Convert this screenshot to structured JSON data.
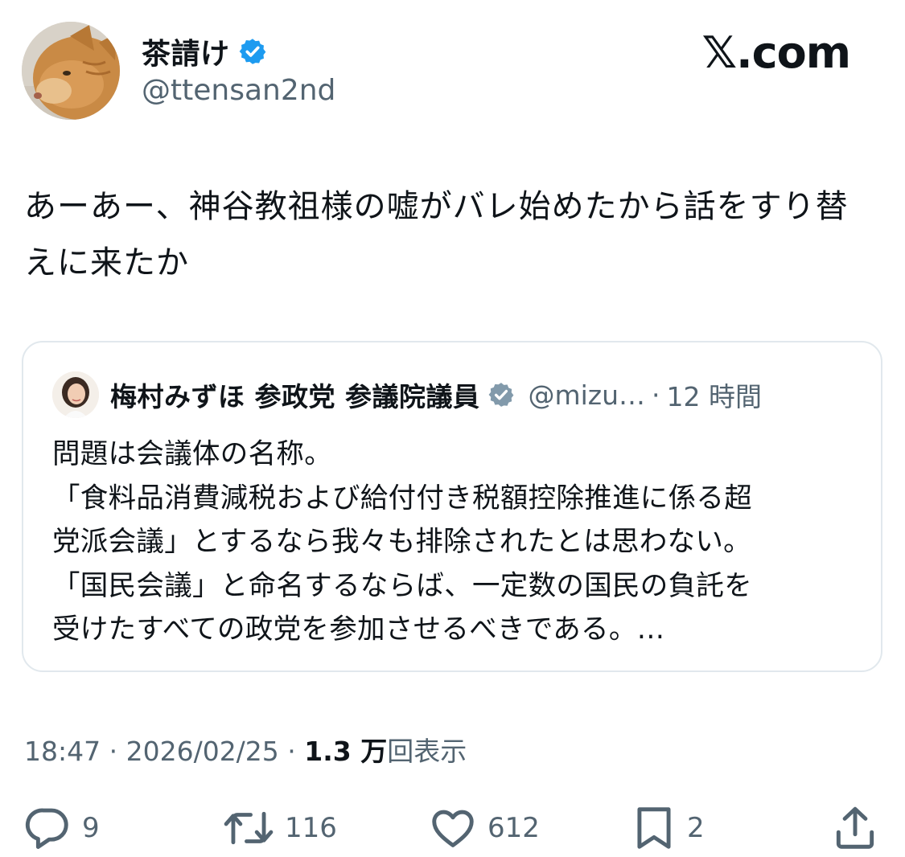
{
  "author": {
    "display_name": "茶請け",
    "handle": "@ttensan2nd",
    "verified": true
  },
  "site_logo": "𝕏.com",
  "tweet": {
    "text": "あーあー、神谷教祖様の嘘がバレ始めたから話をすり替えに来たか"
  },
  "quoted": {
    "display_name": "梅村みずほ 参政党 参議院議員",
    "handle": "@mizu…",
    "separator": "·",
    "time": "12 時間",
    "lines": [
      "問題は会議体の名称。",
      "「食料品消費減税および給付付き税額控除推進に係る超",
      "党派会議」とするなら我々も排除されたとは思わない。",
      "「国民会議」と命名するならば、一定数の国民の負託を",
      "受けたすべての政党を参加させるべきである。…"
    ]
  },
  "meta": {
    "time": "18:47",
    "date": "2026/02/25",
    "views_count": "1.3 万",
    "views_label": "回表示",
    "separator": " · "
  },
  "actions": {
    "reply_count": "9",
    "repost_count": "116",
    "like_count": "612",
    "bookmark_count": "2"
  },
  "colors": {
    "verified": "#1d9bf0",
    "secondary_text": "#536471",
    "primary_text": "#0f1419",
    "border": "#e1e8ed"
  },
  "icons": [
    "verified-badge-icon",
    "reply-icon",
    "repost-icon",
    "like-icon",
    "bookmark-icon",
    "share-icon"
  ]
}
